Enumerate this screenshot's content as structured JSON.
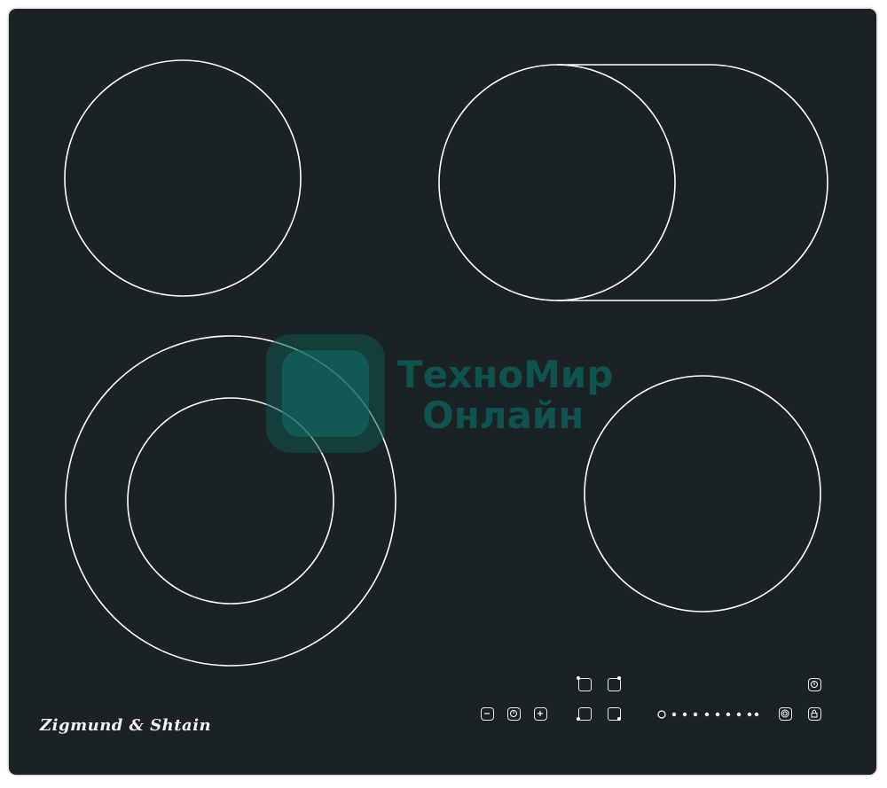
{
  "brand": {
    "name": "Zigmund & Shtain"
  },
  "watermark": {
    "line1": "ТехноМир",
    "line2": "Онлайн"
  },
  "cooking_zones": [
    {
      "name": "rear-left",
      "type": "single"
    },
    {
      "name": "rear-right",
      "type": "oval-extended"
    },
    {
      "name": "front-left",
      "type": "dual-ring"
    },
    {
      "name": "front-right",
      "type": "single"
    }
  ],
  "controls": {
    "power_level_indicators": 9,
    "buttons": [
      "minus-icon",
      "timer-icon",
      "plus-icon",
      "zone-select-icon",
      "power-icon",
      "lock-icon",
      "dual-zone-icon"
    ]
  },
  "colors": {
    "glass": "#1b2223",
    "print": "#ffffff",
    "watermark": "#0f5b58"
  }
}
